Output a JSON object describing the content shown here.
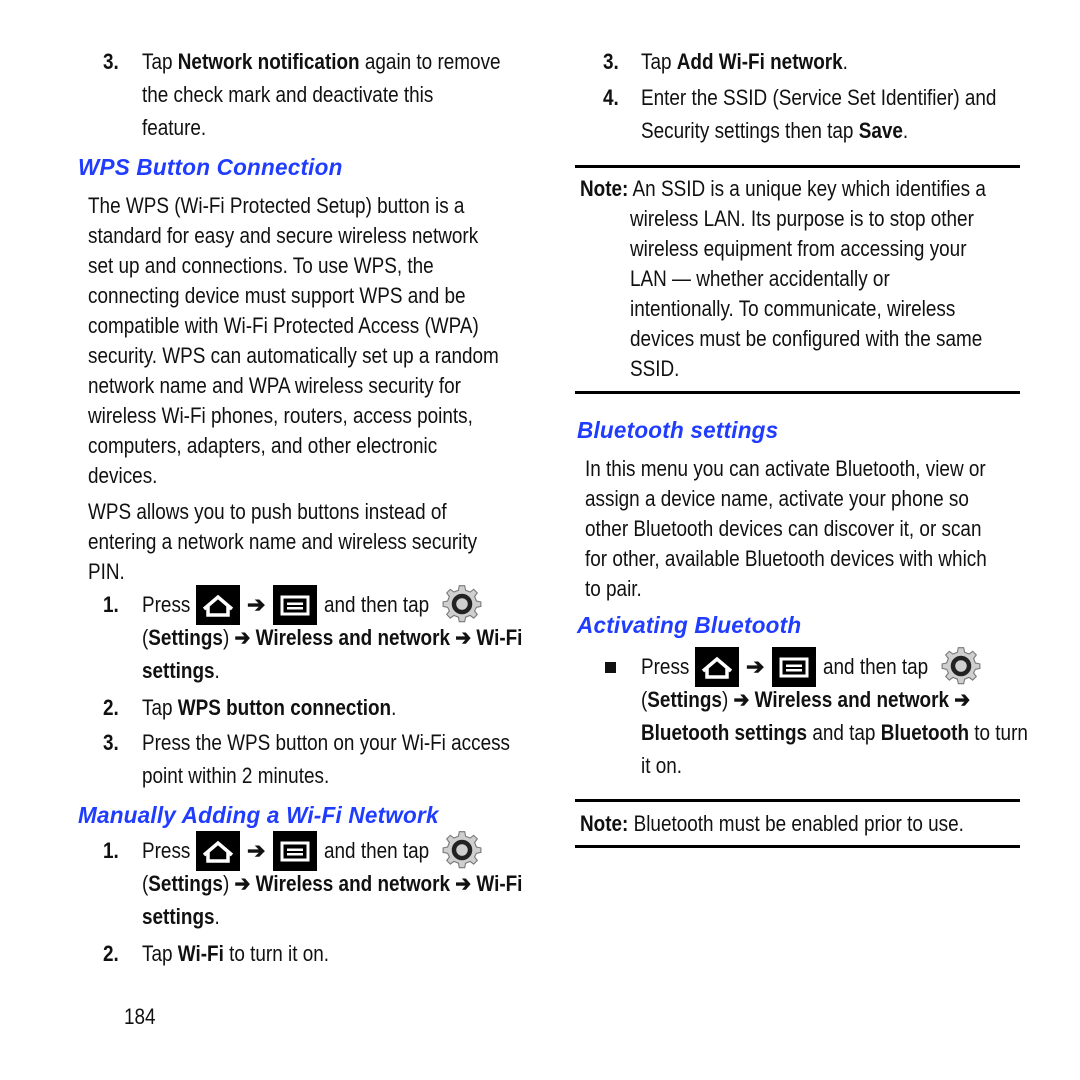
{
  "page_number": "184",
  "colors": {
    "heading": "#1f3cff",
    "text": "#111111",
    "rule": "#000000"
  },
  "icons": {
    "home": "home-key-icon",
    "menu": "menu-key-icon",
    "settings": "settings-gear-icon",
    "arrow": "➔"
  },
  "left": {
    "step3_prev": {
      "num": "3.",
      "l1_a": "Tap ",
      "l1_b": "Network notification",
      "l1_c": " again to remove",
      "l2": "the check mark and deactivate this",
      "l3": "feature."
    },
    "wps_heading": "WPS Button Connection",
    "wps_para1": [
      "The WPS (Wi-Fi Protected Setup) button is a",
      "standard for easy and secure wireless network",
      "set up and connections. To use WPS, the",
      "connecting device must support WPS and be",
      "compatible with Wi-Fi Protected Access (WPA)",
      "security. WPS can automatically set up a random",
      "network name and WPA wireless security for",
      "wireless Wi-Fi phones, routers, access points,",
      "computers, adapters, and other electronic",
      "devices."
    ],
    "wps_para2": [
      "WPS allows you to push buttons instead of",
      "entering a network name and wireless security",
      "PIN."
    ],
    "wps_steps": {
      "s1_num": "1.",
      "press": "Press",
      "and_then_tap": "and then tap",
      "settings_paren_open": "(",
      "settings": "Settings",
      "settings_paren_close": ")",
      "wireless": "Wireless and network",
      "wifi": "Wi-Fi",
      "wifi_settings": "settings",
      "period": ".",
      "s2_num": "2.",
      "s2_a": "Tap ",
      "s2_b": "WPS button connection",
      "s2_c": ".",
      "s3_num": "3.",
      "s3_l1": "Press the WPS button on your Wi-Fi access",
      "s3_l2": "point within 2 minutes."
    },
    "manual_heading": "Manually Adding a Wi-Fi Network",
    "manual_steps": {
      "s1_num": "1.",
      "s2_num": "2.",
      "s2_a": "Tap ",
      "s2_b": "Wi-Fi",
      "s2_c": " to turn it on."
    }
  },
  "right": {
    "step3": {
      "num": "3.",
      "a": "Tap ",
      "b": "Add Wi-Fi network",
      "c": "."
    },
    "step4": {
      "num": "4.",
      "l1": "Enter the SSID (Service Set Identifier) and",
      "l2_a": "Security settings then tap ",
      "l2_b": "Save",
      "l2_c": "."
    },
    "note1": {
      "label": "Note:",
      "lines": [
        " An SSID is a unique key which identifies a",
        "wireless LAN. Its purpose is to stop other",
        "wireless equipment from accessing your",
        "LAN — whether accidentally or",
        "intentionally. To communicate, wireless",
        "devices must be configured with the same",
        "SSID."
      ]
    },
    "bt_heading": "Bluetooth settings",
    "bt_para": [
      "In this menu you can activate Bluetooth, view or",
      "assign a device name, activate your phone so",
      "other Bluetooth devices can discover it, or scan",
      "for other, available Bluetooth devices with which",
      "to pair."
    ],
    "activating_heading": "Activating Bluetooth",
    "activating_step": {
      "press": "Press",
      "and_then_tap": "and then tap",
      "settings": "Settings",
      "wireless": "Wireless and network",
      "bt_settings": "Bluetooth settings",
      "and_tap": " and tap ",
      "bluetooth": "Bluetooth",
      "to_turn": " to turn",
      "it_on": "it on."
    },
    "note2": {
      "label": "Note:",
      "text": " Bluetooth must be enabled prior to use."
    }
  }
}
